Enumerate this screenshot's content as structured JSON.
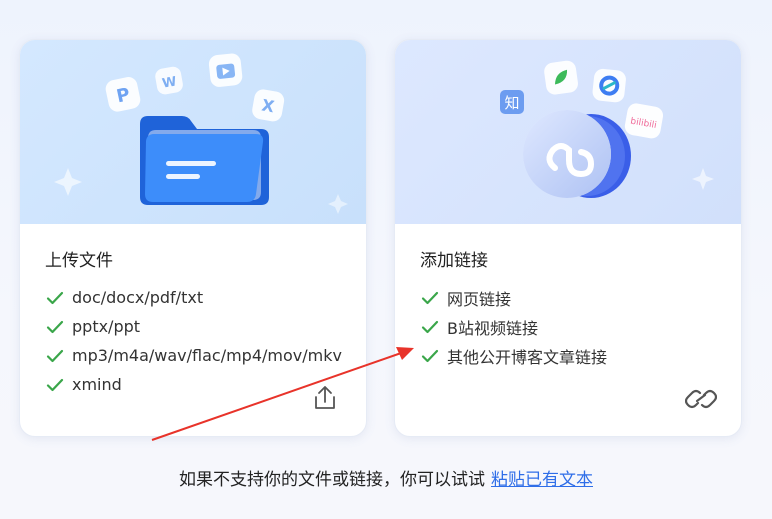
{
  "upload_card": {
    "title": "上传文件",
    "features": [
      "doc/docx/pdf/txt",
      "pptx/ppt",
      "mp3/m4a/wav/flac/mp4/mov/mkv",
      "xmind"
    ],
    "action_icon": "upload-icon",
    "hero_badges": [
      "P",
      "W",
      "X"
    ]
  },
  "link_card": {
    "title": "添加链接",
    "features": [
      "网页链接",
      "B站视频链接",
      "其他公开博客文章链接"
    ],
    "action_icon": "link-icon",
    "hero_badges": [
      "知",
      "bilibili"
    ]
  },
  "footer": {
    "text": "如果不支持你的文件或链接，你可以试试",
    "link_label": "粘贴已有文本"
  },
  "colors": {
    "check": "#3aa64a",
    "link": "#2f6ee8",
    "annotation_arrow": "#e8332a",
    "folder": "#2f7cf6"
  }
}
